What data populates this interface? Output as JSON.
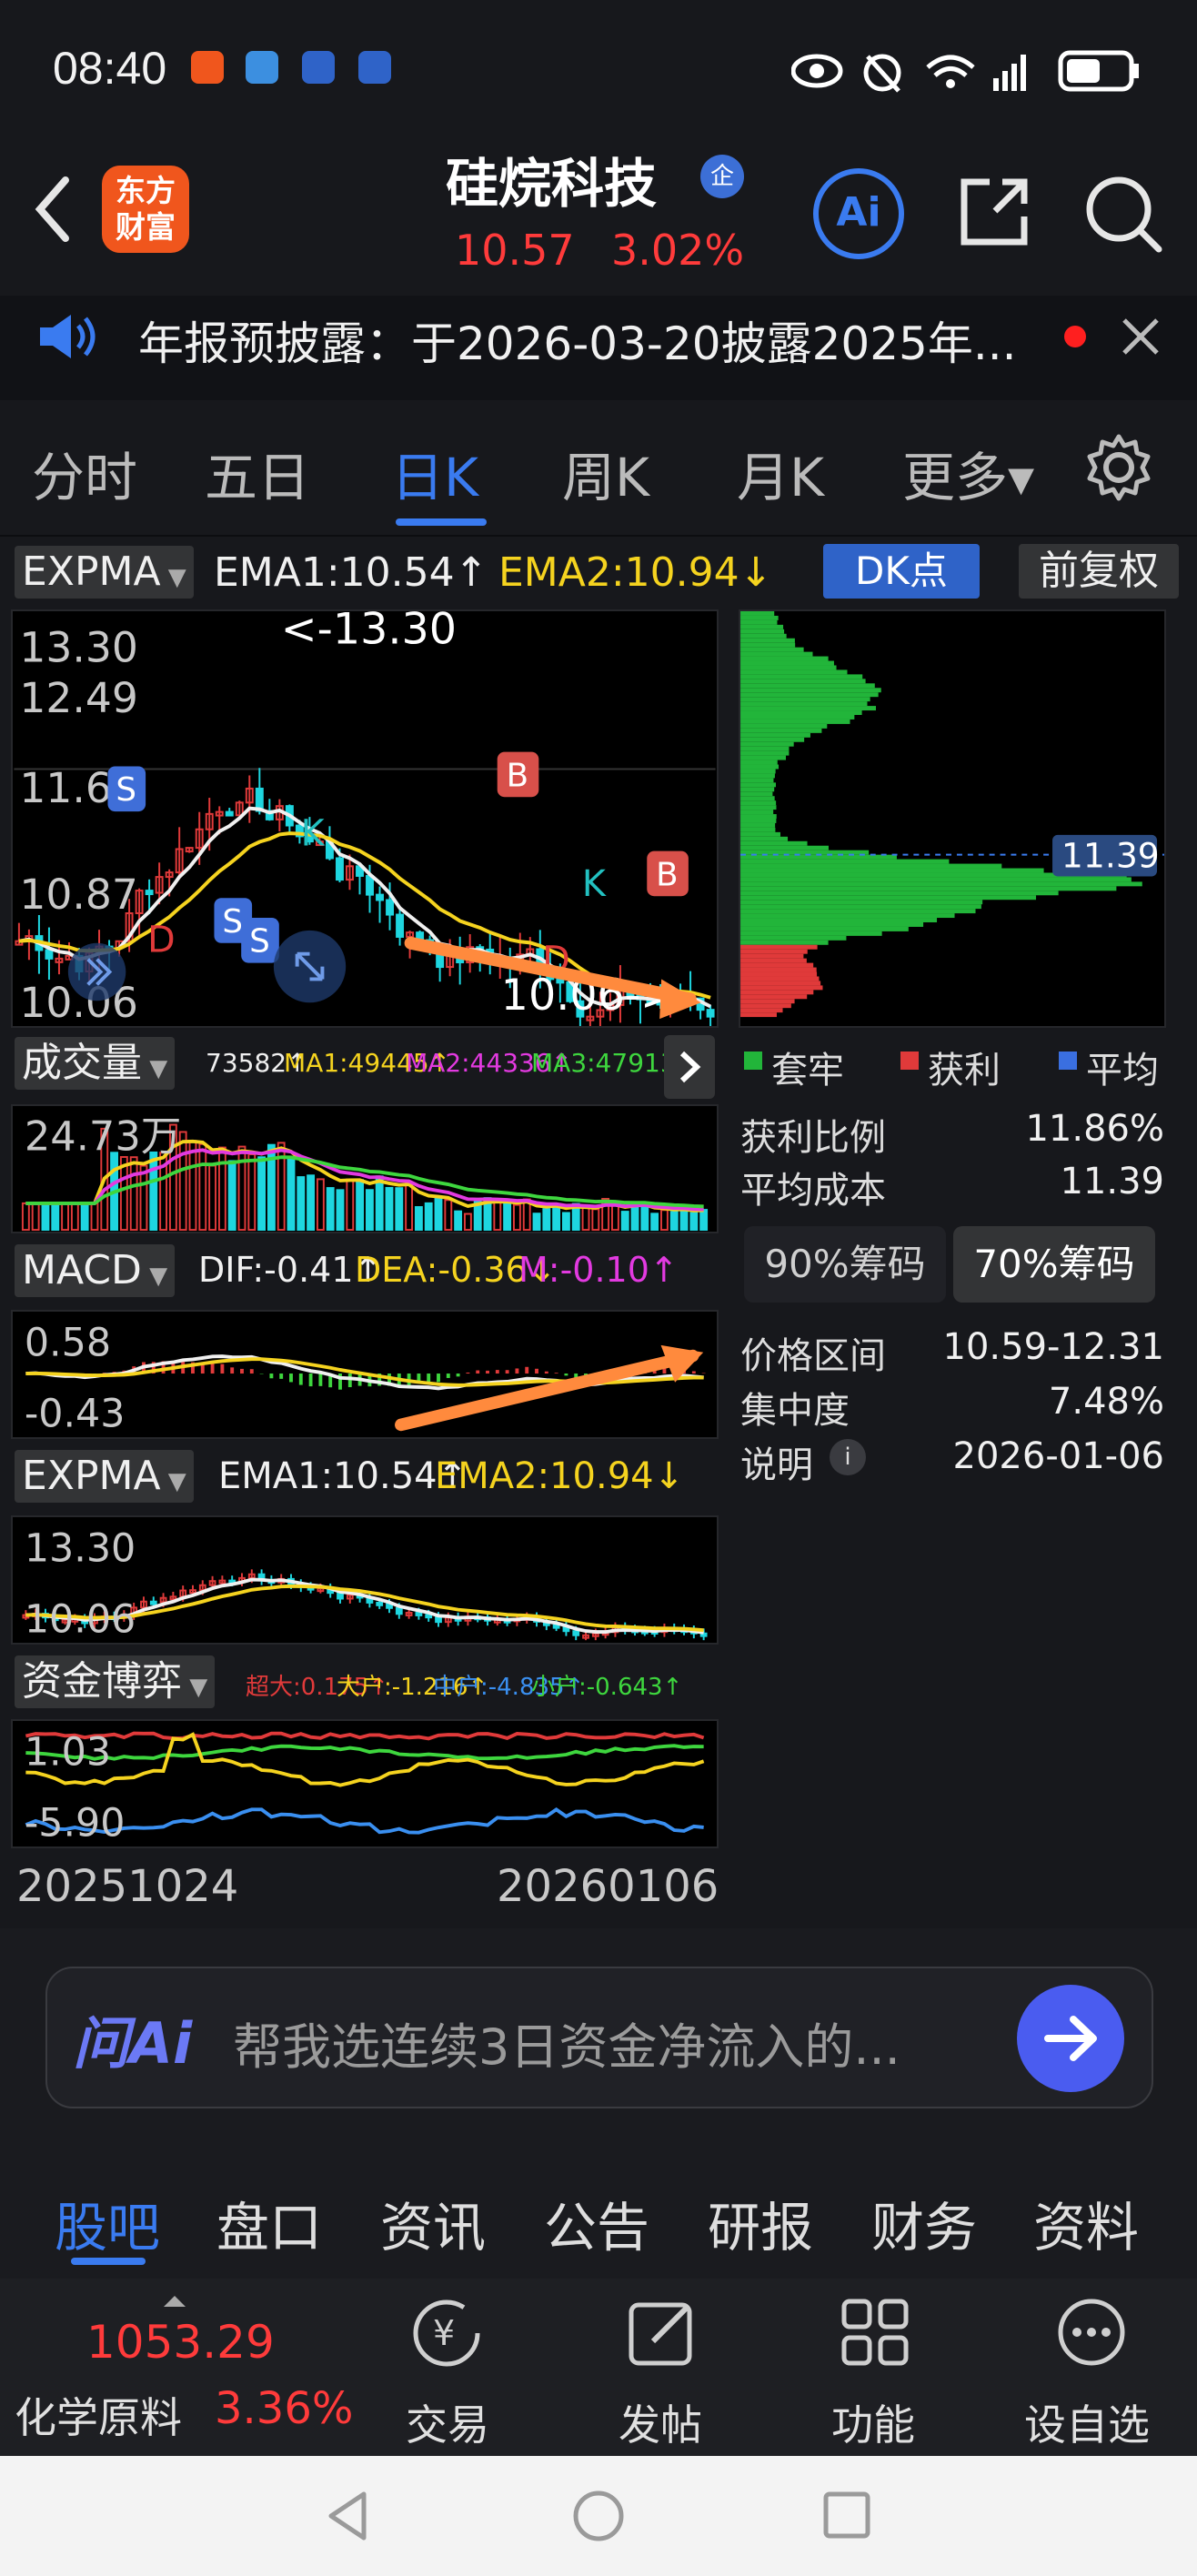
{
  "status_bar": {
    "time": "08:40"
  },
  "header": {
    "logo_text": "东方\n财富",
    "stock_name": "硅烷科技",
    "badge": "企",
    "price": "10.57",
    "change_pct": "3.02%",
    "ai_label": "Ai"
  },
  "notice": {
    "text": "年报预披露：于2026-03-20披露2025年..."
  },
  "tabs": [
    {
      "label": "分时"
    },
    {
      "label": "五日"
    },
    {
      "label": "日K"
    },
    {
      "label": "周K"
    },
    {
      "label": "月K"
    },
    {
      "label": "更多▾"
    }
  ],
  "main_chart": {
    "indicator": "EXPMA",
    "ema1": "EMA1:10.54↑",
    "ema2": "EMA2:10.94↓",
    "dk_label": "DK点",
    "adjust_label": "前复权",
    "y_high": "13.30",
    "y_mid1": "12.49",
    "y_mid2": "11.68",
    "y_mid3": "10.87",
    "y_low": "10.06",
    "max_annotation": "<-13.30",
    "min_annotation": "10.06->"
  },
  "volume": {
    "label": "成交量",
    "value": "73582↑",
    "ma1": "MA1:49445↑",
    "ma2": "MA2:44336↑",
    "ma3": "MA3:47913↑",
    "y_label": "24.73万"
  },
  "macd": {
    "label": "MACD",
    "dif": "DIF:-0.41↑",
    "dea": "DEA:-0.36↓",
    "m": "M:-0.10↑",
    "y_high": "0.58",
    "y_low": "-0.43"
  },
  "expma2": {
    "label": "EXPMA",
    "ema1": "EMA1:10.54↑",
    "ema2": "EMA2:10.94↓",
    "y_high": "13.30",
    "y_low": "10.06"
  },
  "fund_game": {
    "label": "资金博弈",
    "super": "超大:0.175↑",
    "large": "大户:-1.216↑",
    "mid": "中户:-4.835↑",
    "small": "小户:-0.643↑",
    "y_high": "1.03",
    "y_low": "-5.90"
  },
  "date_axis": {
    "start": "20251024",
    "end": "20260106"
  },
  "chip_panel": {
    "avg_label": "11.39",
    "legend": [
      {
        "label": "套牢",
        "color": "#22b53a"
      },
      {
        "label": "获利",
        "color": "#e03a3a"
      },
      {
        "label": "平均",
        "color": "#3a6fe0"
      }
    ],
    "profit_ratio_label": "获利比例",
    "profit_ratio_value": "11.86%",
    "avg_cost_label": "平均成本",
    "avg_cost_value": "11.39",
    "chip90": "90%筹码",
    "chip70": "70%筹码",
    "range_label": "价格区间",
    "range_value": "10.59-12.31",
    "conc_label": "集中度",
    "conc_value": "7.48%",
    "note_label": "说明",
    "note_value": "2026-01-06"
  },
  "ask_ai": {
    "brand": "问Ai",
    "placeholder": "帮我选连续3日资金净流入的..."
  },
  "bottom_tabs": [
    {
      "label": "股吧"
    },
    {
      "label": "盘口"
    },
    {
      "label": "资讯"
    },
    {
      "label": "公告"
    },
    {
      "label": "研报"
    },
    {
      "label": "财务"
    },
    {
      "label": "资料"
    }
  ],
  "dock": {
    "index_value": "1053.29",
    "index_name": "化学原料",
    "index_pct": "3.36%",
    "trade": "交易",
    "post": "发帖",
    "func": "功能",
    "watch": "设自选"
  }
}
